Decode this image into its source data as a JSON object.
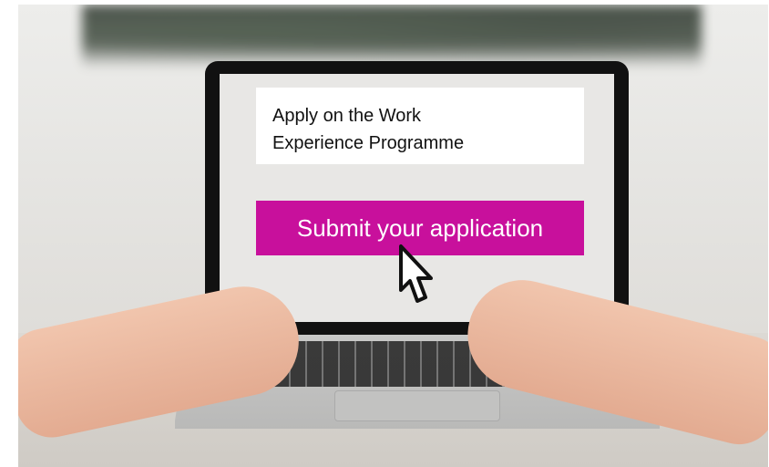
{
  "screen": {
    "heading": "Apply on the Work\nExperience Programme",
    "submit_label": "Submit your application"
  },
  "icons": {
    "pointer": "cursor-arrow-icon"
  },
  "colors": {
    "button": "#c8109c",
    "button_text": "#ffffff",
    "heading_bg": "#ffffff"
  }
}
